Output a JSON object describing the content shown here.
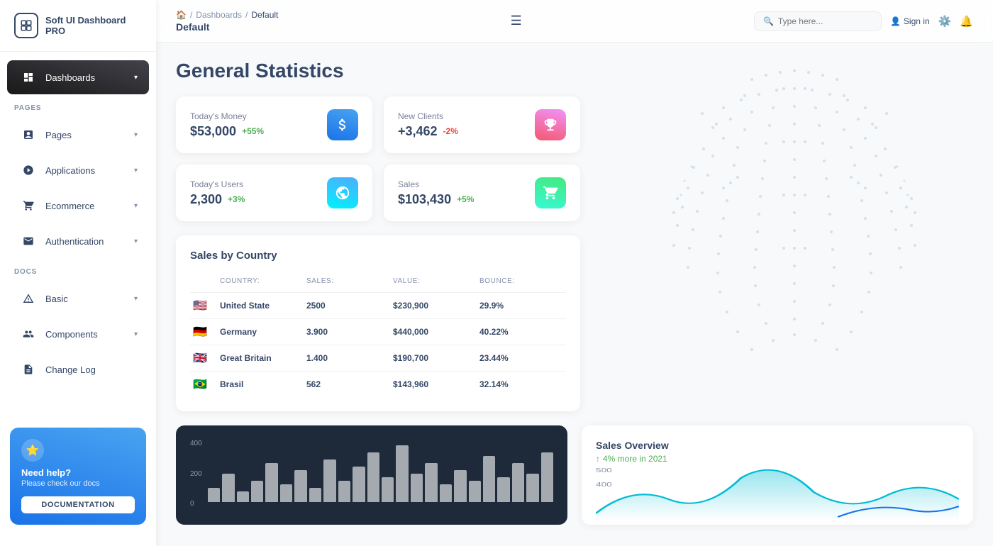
{
  "app": {
    "name": "Soft UI Dashboard PRO"
  },
  "sidebar": {
    "pages_label": "PAGES",
    "docs_label": "DOCS",
    "items": [
      {
        "id": "dashboards",
        "label": "Dashboards",
        "active": true,
        "icon": "dashboard-icon"
      },
      {
        "id": "pages",
        "label": "Pages",
        "active": false,
        "icon": "pages-icon"
      },
      {
        "id": "applications",
        "label": "Applications",
        "active": false,
        "icon": "applications-icon"
      },
      {
        "id": "ecommerce",
        "label": "Ecommerce",
        "active": false,
        "icon": "ecommerce-icon"
      },
      {
        "id": "authentication",
        "label": "Authentication",
        "active": false,
        "icon": "auth-icon"
      },
      {
        "id": "basic",
        "label": "Basic",
        "active": false,
        "icon": "basic-icon"
      },
      {
        "id": "components",
        "label": "Components",
        "active": false,
        "icon": "components-icon"
      },
      {
        "id": "changelog",
        "label": "Change Log",
        "active": false,
        "icon": "changelog-icon"
      }
    ],
    "help": {
      "title": "Need help?",
      "subtitle": "Please check our docs",
      "button_label": "DOCUMENTATION"
    }
  },
  "topbar": {
    "breadcrumb": [
      "🏠",
      "Dashboards",
      "Default"
    ],
    "page_title": "Default",
    "search_placeholder": "Type here...",
    "signin_label": "Sign in",
    "hamburger": "☰"
  },
  "main": {
    "title": "General Statistics",
    "stats": [
      {
        "label": "Today's Money",
        "value": "$53,000",
        "change": "+55%",
        "change_type": "pos",
        "icon": "dollar-icon"
      },
      {
        "label": "New Clients",
        "value": "+3,462",
        "change": "-2%",
        "change_type": "neg",
        "icon": "trophy-icon"
      },
      {
        "label": "Today's Users",
        "value": "2,300",
        "change": "+3%",
        "change_type": "pos",
        "icon": "globe-icon"
      },
      {
        "label": "Sales",
        "value": "$103,430",
        "change": "+5%",
        "change_type": "pos",
        "icon": "cart-icon"
      }
    ],
    "sales_by_country": {
      "title": "Sales by Country",
      "columns": [
        "Country:",
        "Sales:",
        "Value:",
        "Bounce:"
      ],
      "rows": [
        {
          "flag": "🇺🇸",
          "country": "United State",
          "sales": "2500",
          "value": "$230,900",
          "bounce": "29.9%"
        },
        {
          "flag": "🇩🇪",
          "country": "Germany",
          "sales": "3.900",
          "value": "$440,000",
          "bounce": "40.22%"
        },
        {
          "flag": "🇬🇧",
          "country": "Great Britain",
          "sales": "1.400",
          "value": "$190,700",
          "bounce": "23.44%"
        },
        {
          "flag": "🇧🇷",
          "country": "Brasil",
          "sales": "562",
          "value": "$143,960",
          "bounce": "32.14%"
        }
      ]
    },
    "chart": {
      "y_labels": [
        "400",
        "200",
        "0"
      ],
      "bars": [
        20,
        40,
        15,
        30,
        55,
        25,
        45,
        20,
        60,
        30,
        50,
        70,
        35,
        80,
        40,
        55,
        25,
        45,
        30,
        65,
        35,
        55,
        40,
        70
      ]
    },
    "sales_overview": {
      "title": "Sales Overview",
      "change": "4% more in 2021",
      "y_labels": [
        "500",
        "400"
      ]
    }
  }
}
